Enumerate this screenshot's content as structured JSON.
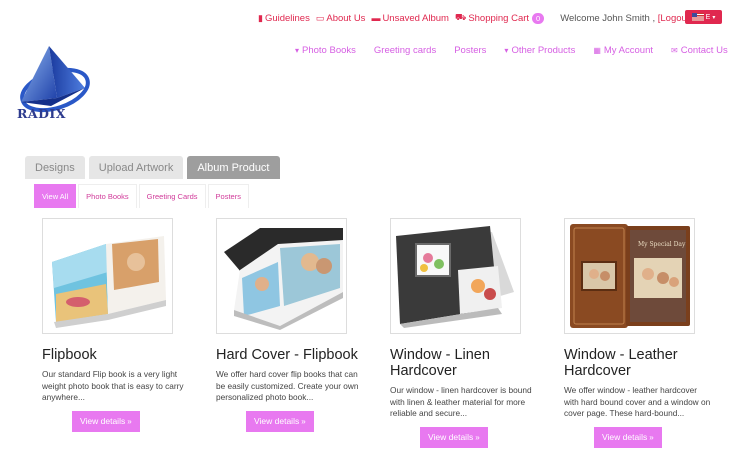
{
  "topbar": {
    "links": [
      {
        "icon": "book-icon",
        "glyph": "▮",
        "label": "Guidelines"
      },
      {
        "icon": "info-icon",
        "glyph": "▭",
        "label": "About Us"
      },
      {
        "icon": "folder-icon",
        "glyph": "▬",
        "label": "Unsaved Album"
      },
      {
        "icon": "cart-icon",
        "glyph": "⛟",
        "label": "Shopping Cart"
      }
    ],
    "cart_count": "0",
    "welcome": "Welcome John Smith ,",
    "logout": "[Logout]",
    "language": "E"
  },
  "mainnav": [
    {
      "icon": "caret-down-icon",
      "glyph": "▾",
      "label": "Photo Books"
    },
    {
      "icon": "",
      "glyph": "",
      "label": "Greeting cards"
    },
    {
      "icon": "",
      "glyph": "",
      "label": "Posters"
    },
    {
      "icon": "caret-down-icon",
      "glyph": "▾",
      "label": "Other Products"
    },
    {
      "icon": "grid-icon",
      "glyph": "▦",
      "label": "My Account"
    },
    {
      "icon": "envelope-icon",
      "glyph": "✉",
      "label": "Contact Us"
    }
  ],
  "logo": {
    "text": "RADIX"
  },
  "tabs": [
    {
      "label": "Designs",
      "active": false
    },
    {
      "label": "Upload Artwork",
      "active": false
    },
    {
      "label": "Album Product",
      "active": true
    }
  ],
  "subtabs": [
    {
      "label": "View All",
      "active": true
    },
    {
      "label": "Photo Books",
      "active": false
    },
    {
      "label": "Greeting Cards",
      "active": false
    },
    {
      "label": "Posters",
      "active": false
    }
  ],
  "products": [
    {
      "title": "Flipbook",
      "description": "Our standard Flip book is a very light weight photo book that is easy to carry anywhere...",
      "button": "View details",
      "chevron": "»"
    },
    {
      "title": "Hard Cover - Flipbook",
      "description": "We offer hard cover flip books that can be easily customized. Create your own personalized photo book...",
      "button": "View details",
      "chevron": "»"
    },
    {
      "title": "Window - Linen Hardcover",
      "description": "Our window - linen hardcover is bound with linen & leather material for more reliable and secure...",
      "button": "View details",
      "chevron": "»"
    },
    {
      "title": "Window - Leather Hardcover",
      "description": "We offer window - leather hardcover with hard bound cover and a window on cover page. These hard-bound...",
      "button": "View details",
      "chevron": "»"
    }
  ],
  "colors": {
    "accent_pink": "#e879f0",
    "link_red": "#e0284f",
    "nav_pink": "#d65fe3",
    "tab_active": "#9e9e9e"
  }
}
